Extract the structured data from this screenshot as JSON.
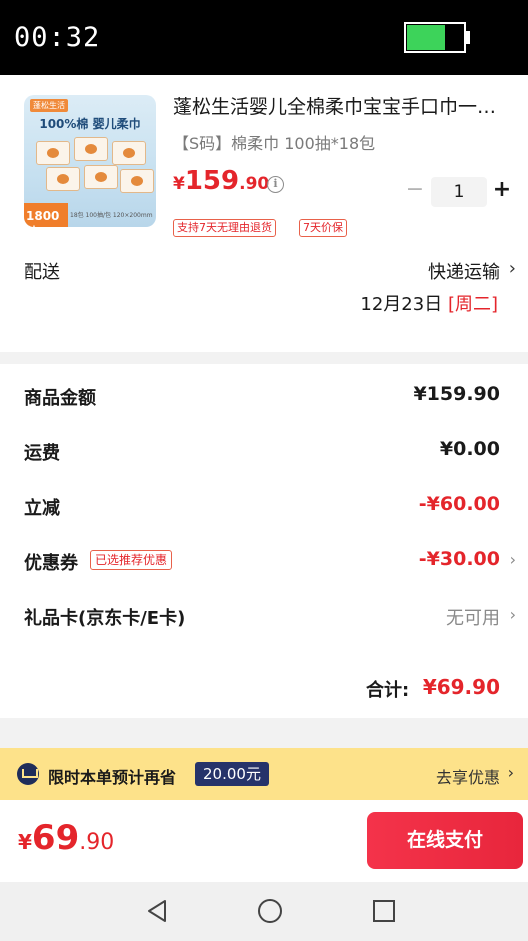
{
  "status_bar": {
    "time": "00:32",
    "battery_level": 0.65
  },
  "product": {
    "image": {
      "brand": "蓬松生活",
      "headline": "100%棉 婴儿柔巾",
      "badge": "1800抽",
      "spec": "18包 100抽/包 120×200mm"
    },
    "title": "蓬松生活婴儿全棉柔巾宝宝手口巾一…",
    "spec": "【S码】棉柔巾 100抽*18包",
    "price": {
      "currency": "¥",
      "integer": "159",
      "decimal": ".90"
    },
    "quantity": "1",
    "minus_label": "−",
    "plus_label": "+",
    "tags": [
      "支持7天无理由退货",
      "7天价保"
    ]
  },
  "delivery": {
    "label": "配送",
    "method": "快递运输",
    "date": "12月23日",
    "weekday": "[周二]"
  },
  "costs": {
    "subtotal_label": "商品金额",
    "subtotal_value": "¥159.90",
    "shipping_label": "运费",
    "shipping_value": "¥0.00",
    "discount_label": "立减",
    "discount_value": "-¥60.00",
    "coupon_label": "优惠券",
    "coupon_tag": "已选推荐优惠",
    "coupon_value": "-¥30.00",
    "giftcard_label": "礼品卡(京东卡/E卡)",
    "giftcard_value": "无可用",
    "total_label": "合计:",
    "total_value": "¥69.90"
  },
  "promo": {
    "text": "限时本单预计再省",
    "amount": "20.00元",
    "action": "去享优惠"
  },
  "pay_bar": {
    "total": {
      "currency": "¥",
      "integer": "69",
      "decimal": ".90"
    },
    "button_label": "在线支付"
  },
  "colors": {
    "accent_red": "#e4252b",
    "promo_yellow": "#fde28a",
    "battery_green": "#3dd35a"
  }
}
